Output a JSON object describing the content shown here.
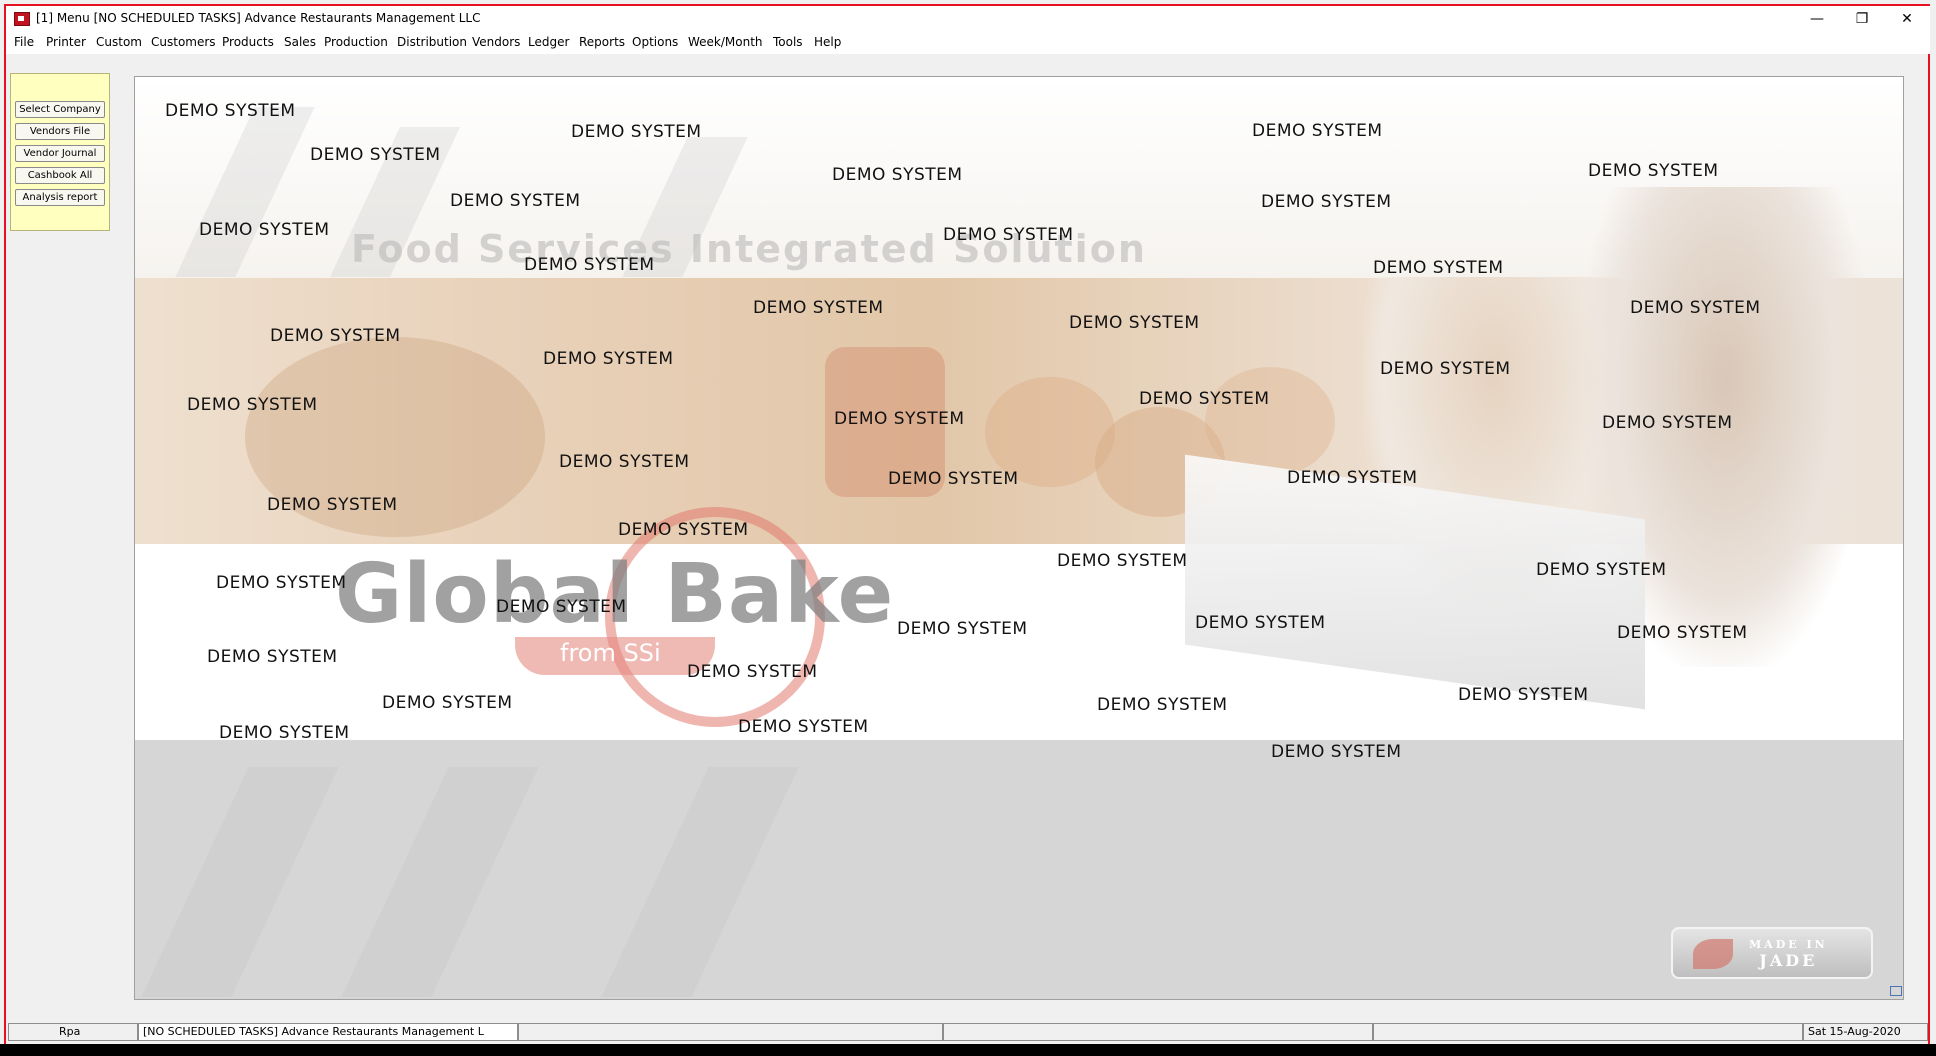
{
  "window": {
    "title": "[1] Menu [NO SCHEDULED TASKS] Advance Restaurants Management LLC",
    "minimize_glyph": "—",
    "restore_glyph": "❐",
    "close_glyph": "✕"
  },
  "menu": [
    "File",
    "Printer",
    "Custom",
    "Customers",
    "Products",
    "Sales",
    "Production",
    "Distribution",
    "Vendors",
    "Ledger",
    "Reports",
    "Options",
    "Week/Month",
    "Tools",
    "Help"
  ],
  "shortcuts": [
    "Select Company",
    "Vendors File",
    "Vendor Journal",
    "Cashbook All",
    "Analysis report"
  ],
  "splash": {
    "tagline": "Food Services Integrated Solution",
    "logo": "Global Bake",
    "logo_sub": "from SSi",
    "badge_line1": "MADE IN",
    "badge_line2": "JADE"
  },
  "watermark": "DEMO SYSTEM",
  "status": {
    "user": "Rpa",
    "task": "[NO SCHEDULED TASKS] Advance Restaurants Management L",
    "date": "Sat 15-Aug-2020"
  },
  "colors": {
    "frame_border": "#e81123",
    "shortcut_panel": "#ffffc0"
  }
}
